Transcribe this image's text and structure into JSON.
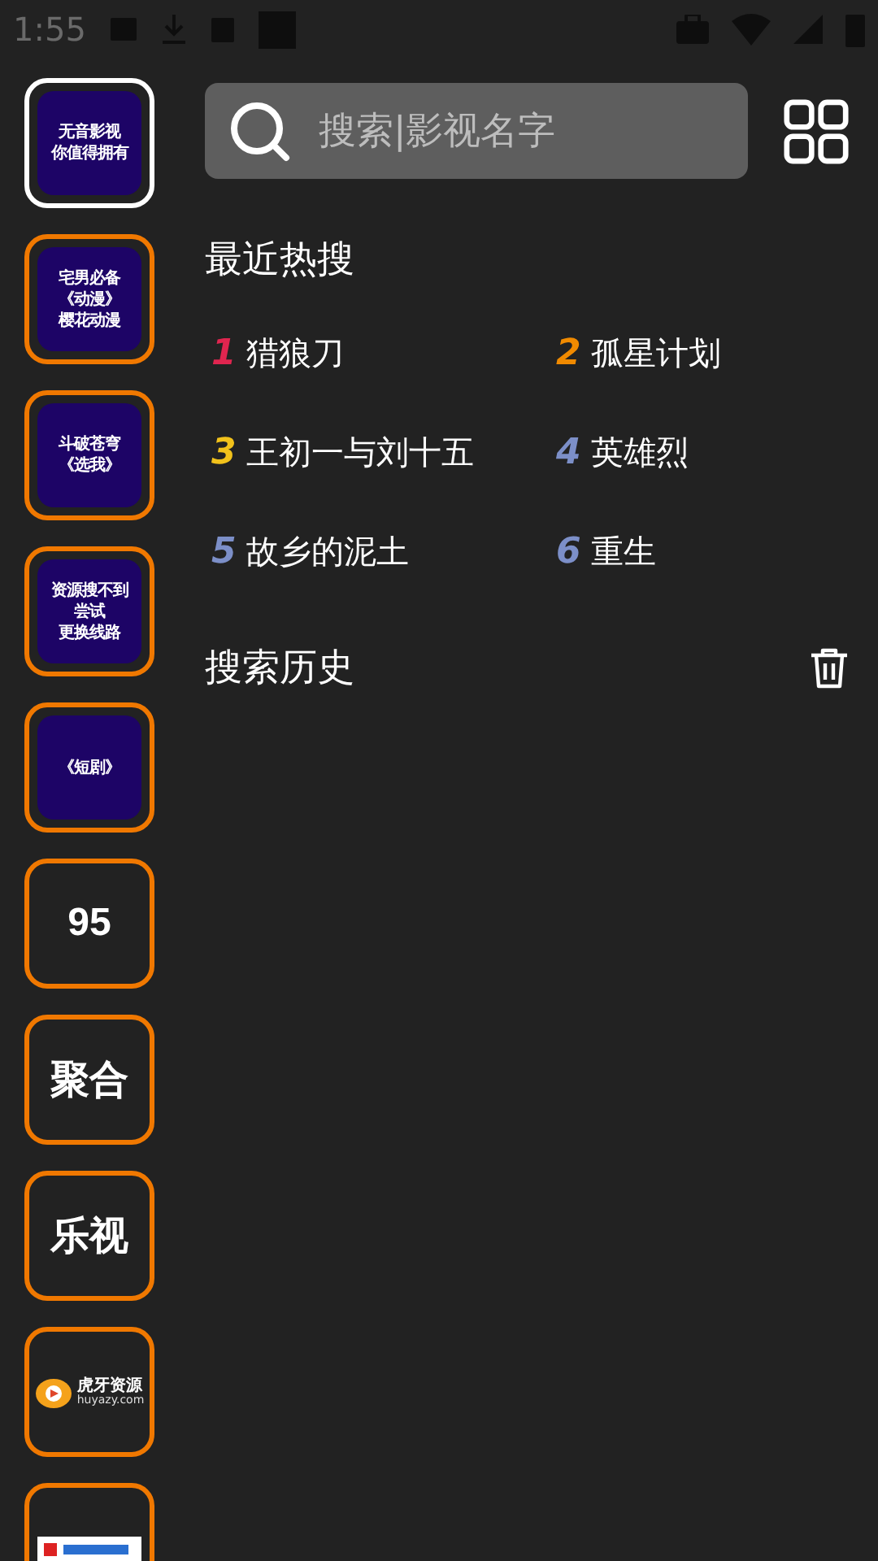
{
  "status_bar": {
    "time": "1:55"
  },
  "sidebar": {
    "items": [
      {
        "kind": "banner",
        "lines": [
          "无音影视",
          "你值得拥有"
        ],
        "selected": true
      },
      {
        "kind": "banner",
        "lines": [
          "宅男必备",
          "《动漫》",
          "樱花动漫"
        ],
        "selected": false
      },
      {
        "kind": "banner",
        "lines": [
          "斗破苍穹",
          "《选我》"
        ],
        "selected": false
      },
      {
        "kind": "banner",
        "lines": [
          "资源搜不到",
          "尝试",
          "更换线路"
        ],
        "selected": false
      },
      {
        "kind": "banner",
        "lines": [
          "《短剧》"
        ],
        "selected": false
      },
      {
        "kind": "label",
        "label": "95",
        "selected": false
      },
      {
        "kind": "label",
        "label": "聚合",
        "selected": false
      },
      {
        "kind": "label",
        "label": "乐视",
        "selected": false
      },
      {
        "kind": "logo",
        "name": "虎牙资源",
        "site": "huyazy.com",
        "selected": false
      },
      {
        "kind": "picture",
        "selected": false
      }
    ]
  },
  "search": {
    "placeholder": "搜索|影视名字"
  },
  "hot_searches": {
    "title": "最近热搜",
    "items": [
      {
        "rank": "1",
        "title": "猎狼刀",
        "color": "#e0254f"
      },
      {
        "rank": "2",
        "title": "孤星计划",
        "color": "#f08a00"
      },
      {
        "rank": "3",
        "title": "王初一与刘十五",
        "color": "#f2c21b"
      },
      {
        "rank": "4",
        "title": "英雄烈",
        "color": "#7c8fc8"
      },
      {
        "rank": "5",
        "title": "故乡的泥土",
        "color": "#7c8fc8"
      },
      {
        "rank": "6",
        "title": "重生",
        "color": "#7c8fc8"
      }
    ]
  },
  "history": {
    "title": "搜索历史"
  }
}
